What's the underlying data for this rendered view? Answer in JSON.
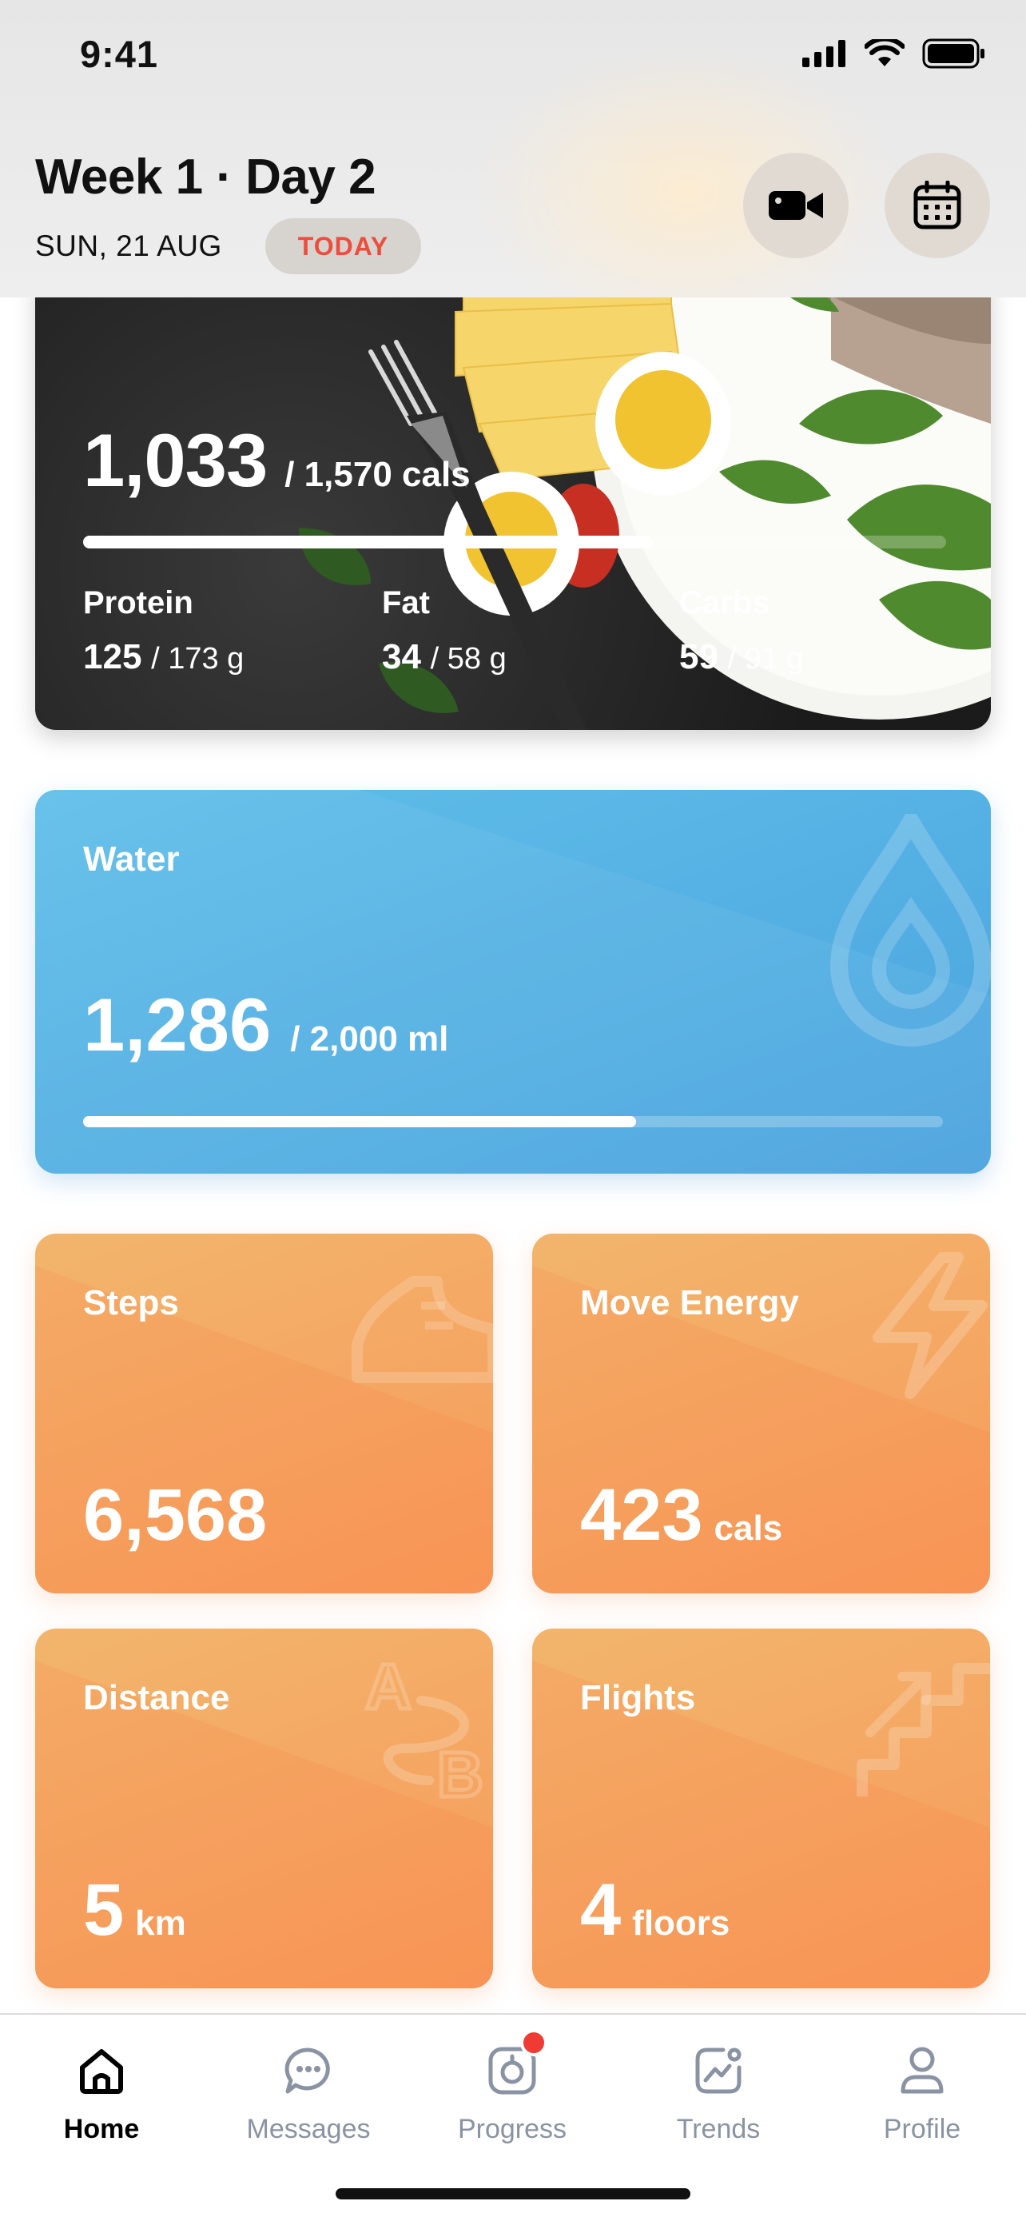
{
  "status_bar": {
    "time": "9:41"
  },
  "header": {
    "title": "Week 1 · Day 2",
    "date": "SUN, 21 AUG",
    "badge": "TODAY",
    "video_icon": "video-camera-icon",
    "calendar_icon": "calendar-icon"
  },
  "nutrition": {
    "calories": "1,033",
    "calories_total": "/  1,570 cals",
    "progress": 0.66,
    "macros": [
      {
        "label": "Protein",
        "value": "125",
        "total": "/ 173 g"
      },
      {
        "label": "Fat",
        "value": "34",
        "total": "/ 58 g"
      },
      {
        "label": "Carbs",
        "value": "59",
        "total": "/ 91 g"
      }
    ]
  },
  "water": {
    "title": "Water",
    "value": "1,286",
    "total": "/  2,000 ml",
    "progress": 0.643,
    "icon": "water-drop-icon"
  },
  "tiles": {
    "steps": {
      "title": "Steps",
      "value": "6,568",
      "unit": "",
      "icon": "sneaker-icon"
    },
    "move": {
      "title": "Move Energy",
      "value": "423",
      "unit": "cals",
      "icon": "lightning-icon"
    },
    "distance": {
      "title": "Distance",
      "value": "5",
      "unit": "km",
      "icon": "a-to-b-icon"
    },
    "flights": {
      "title": "Flights",
      "value": "4",
      "unit": "floors",
      "icon": "stairs-icon"
    }
  },
  "tabbar": {
    "items": [
      {
        "label": "Home",
        "icon": "home-icon",
        "active": true
      },
      {
        "label": "Messages",
        "icon": "chat-bubble-icon",
        "active": false
      },
      {
        "label": "Progress",
        "icon": "scale-icon",
        "active": false,
        "badge": true
      },
      {
        "label": "Trends",
        "icon": "trends-chart-icon",
        "active": false
      },
      {
        "label": "Profile",
        "icon": "person-icon",
        "active": false
      }
    ]
  },
  "colors": {
    "accent_red": "#ec4d3d",
    "water_blue": "#4aa3de",
    "tile_orange": "#f79a5a",
    "tab_inactive": "#8a93a3"
  }
}
